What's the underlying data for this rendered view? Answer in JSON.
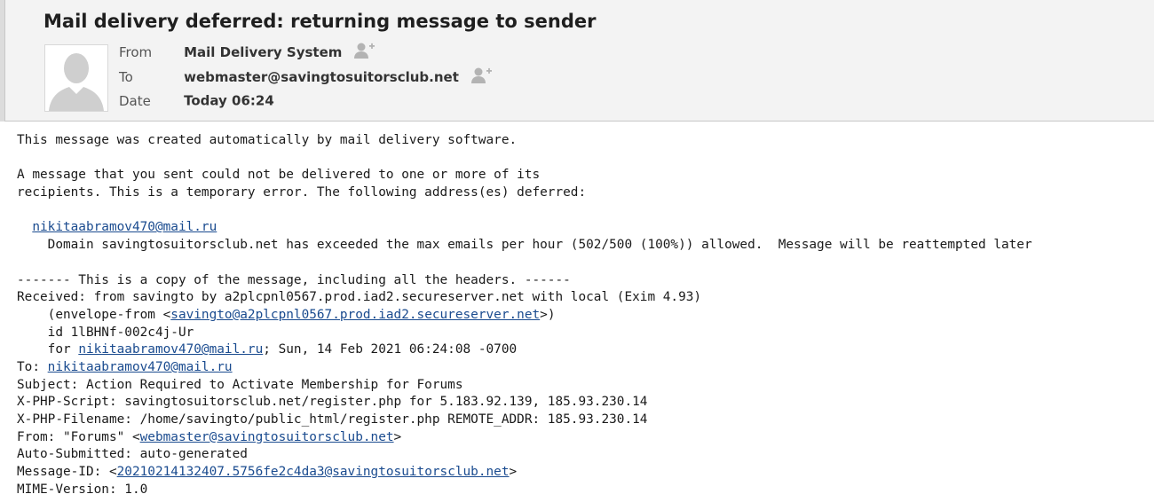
{
  "header": {
    "subject": "Mail delivery deferred: returning message to sender",
    "from_label": "From",
    "from_value": "Mail Delivery System",
    "to_label": "To",
    "to_value": "webmaster@savingtosuitorsclub.net",
    "date_label": "Date",
    "date_value": "Today 06:24"
  },
  "icons": {
    "avatar": "person-silhouette-icon",
    "add_contact": "add-contact-icon"
  },
  "body": {
    "l1": "This message was created automatically by mail delivery software.",
    "l3": "A message that you sent could not be delivered to one or more of its",
    "l4": "recipients. This is a temporary error. The following address(es) deferred:",
    "l6_link": "nikitaabramov470@mail.ru",
    "l7": "    Domain savingtosuitorsclub.net has exceeded the max emails per hour (502/500 (100%)) allowed.  Message will be reattempted later",
    "l9": "------- This is a copy of the message, including all the headers. ------",
    "l10": "Received: from savingto by a2plcpnl0567.prod.iad2.secureserver.net with local (Exim 4.93)",
    "l11_pre": "    (envelope-from <",
    "l11_link": "savingto@a2plcpnl0567.prod.iad2.secureserver.net",
    "l11_post": ">)",
    "l12": "    id 1lBHNf-002c4j-Ur",
    "l13_pre": "    for ",
    "l13_link": "nikitaabramov470@mail.ru",
    "l13_post": "; Sun, 14 Feb 2021 06:24:08 -0700",
    "l14_pre": "To: ",
    "l14_link": "nikitaabramov470@mail.ru",
    "l15": "Subject: Action Required to Activate Membership for Forums",
    "l16": "X-PHP-Script: savingtosuitorsclub.net/register.php for 5.183.92.139, 185.93.230.14",
    "l17": "X-PHP-Filename: /home/savingto/public_html/register.php REMOTE_ADDR: 185.93.230.14",
    "l18_pre": "From: \"Forums\" <",
    "l18_link": "webmaster@savingtosuitorsclub.net",
    "l18_post": ">",
    "l19": "Auto-Submitted: auto-generated",
    "l20_pre": "Message-ID: <",
    "l20_link": "20210214132407.5756fe2c4da3@savingtosuitorsclub.net",
    "l20_post": ">",
    "l21": "MIME-Version: 1.0"
  }
}
